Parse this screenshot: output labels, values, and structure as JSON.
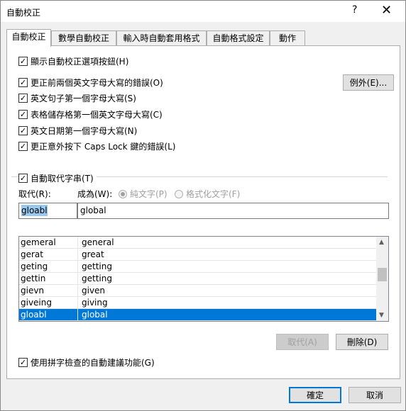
{
  "window": {
    "title": "自動校正",
    "help": "?",
    "close": "✕"
  },
  "tabs": [
    "自動校正",
    "數學自動校正",
    "輸入時自動套用格式",
    "自動格式設定",
    "動作"
  ],
  "options": [
    {
      "label": "顯示自動校正選項按鈕(H)",
      "checked": true
    },
    {
      "label": "更正前兩個英文字母大寫的錯誤(O)",
      "checked": true
    },
    {
      "label": "英文句子第一個字母大寫(S)",
      "checked": true
    },
    {
      "label": "表格儲存格第一個英文字母大寫(C)",
      "checked": true
    },
    {
      "label": "英文日期第一個字母大寫(N)",
      "checked": true
    },
    {
      "label": "更正意外按下 Caps Lock 鍵的錯誤(L)",
      "checked": true
    }
  ],
  "exceptions_button": "例外(E)...",
  "replace_group": {
    "checkbox_label": "自動取代字串(T)",
    "checked": true,
    "replace_label": "取代(R):",
    "with_label": "成為(W):",
    "plain_text": "純文字(P)",
    "formatted_text": "格式化文字(F)",
    "replace_value": "gloabl",
    "with_value": "global"
  },
  "entries": [
    {
      "from": "gemeral",
      "to": "general"
    },
    {
      "from": "gerat",
      "to": "great"
    },
    {
      "from": "geting",
      "to": "getting"
    },
    {
      "from": "gettin",
      "to": "getting"
    },
    {
      "from": "gievn",
      "to": "given"
    },
    {
      "from": "giveing",
      "to": "giving"
    },
    {
      "from": "gloabl",
      "to": "global"
    }
  ],
  "selected_entry": 6,
  "replace_button": "取代(A)",
  "delete_button": "刪除(D)",
  "spell_option": {
    "label": "使用拼字檢查的自動建議功能(G)",
    "checked": true
  },
  "ok_button": "確定",
  "cancel_button": "取消",
  "glyphs": {
    "check": "✓",
    "scroll_up": "▲",
    "scroll_down": "▼"
  }
}
